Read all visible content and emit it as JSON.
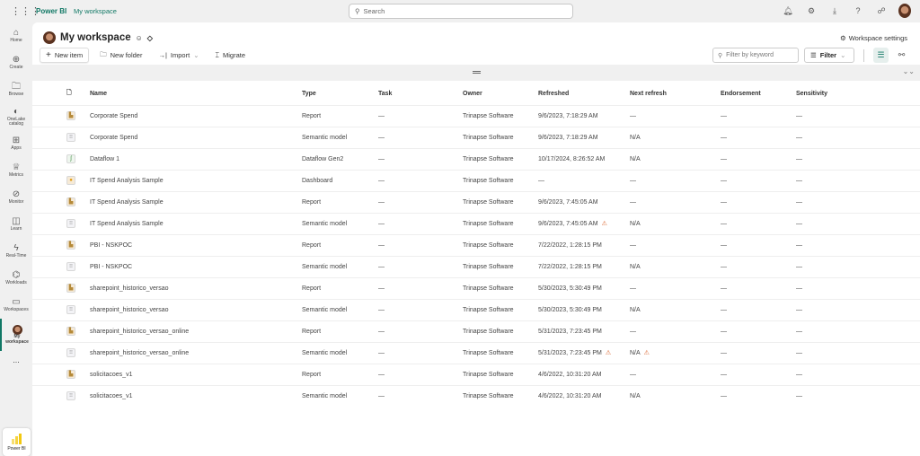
{
  "topbar": {
    "brand": "Power BI",
    "breadcrumb": "My workspace",
    "search_placeholder": "Search"
  },
  "sidebar": {
    "items": [
      {
        "label": "Home",
        "icon": "home-icon"
      },
      {
        "label": "Create",
        "icon": "plus-circle-icon"
      },
      {
        "label": "Browse",
        "icon": "folder-icon"
      },
      {
        "label": "OneLake catalog",
        "icon": "onelake-icon"
      },
      {
        "label": "Apps",
        "icon": "apps-icon"
      },
      {
        "label": "Metrics",
        "icon": "trophy-icon"
      },
      {
        "label": "Monitor",
        "icon": "monitor-icon"
      },
      {
        "label": "Learn",
        "icon": "book-icon"
      },
      {
        "label": "Real-Time",
        "icon": "lightning-icon"
      },
      {
        "label": "Workloads",
        "icon": "workloads-icon"
      },
      {
        "label": "Workspaces",
        "icon": "workspaces-icon"
      },
      {
        "label": "My workspace",
        "icon": "avatar"
      }
    ],
    "more": "...",
    "app_label": "Power BI"
  },
  "header": {
    "title": "My workspace",
    "settings": "Workspace settings",
    "new_item": "New item",
    "new_folder": "New folder",
    "import": "Import",
    "migrate": "Migrate",
    "filter_placeholder": "Filter by keyword",
    "filter": "Filter"
  },
  "table": {
    "columns": [
      "Name",
      "Type",
      "Task",
      "Owner",
      "Refreshed",
      "Next refresh",
      "Endorsement",
      "Sensitivity"
    ],
    "rows": [
      {
        "icon": "report",
        "name": "Corporate Spend",
        "type": "Report",
        "task": "—",
        "owner": "Trinapse Software",
        "refreshed": "9/6/2023, 7:18:29 AM",
        "refreshed_warn": false,
        "next": "—",
        "next_warn": false,
        "endorsement": "—",
        "sensitivity": "—"
      },
      {
        "icon": "model",
        "name": "Corporate Spend",
        "type": "Semantic model",
        "task": "—",
        "owner": "Trinapse Software",
        "refreshed": "9/6/2023, 7:18:29 AM",
        "refreshed_warn": false,
        "next": "N/A",
        "next_warn": false,
        "endorsement": "—",
        "sensitivity": "—"
      },
      {
        "icon": "dataflow",
        "name": "Dataflow 1",
        "type": "Dataflow Gen2",
        "task": "—",
        "owner": "Trinapse Software",
        "refreshed": "10/17/2024, 8:26:52 AM",
        "refreshed_warn": false,
        "next": "N/A",
        "next_warn": false,
        "endorsement": "—",
        "sensitivity": "—"
      },
      {
        "icon": "dashboard",
        "name": "IT Spend Analysis Sample",
        "type": "Dashboard",
        "task": "—",
        "owner": "Trinapse Software",
        "refreshed": "—",
        "refreshed_warn": false,
        "next": "—",
        "next_warn": false,
        "endorsement": "—",
        "sensitivity": "—"
      },
      {
        "icon": "report",
        "name": "IT Spend Analysis Sample",
        "type": "Report",
        "task": "—",
        "owner": "Trinapse Software",
        "refreshed": "9/6/2023, 7:45:05 AM",
        "refreshed_warn": false,
        "next": "—",
        "next_warn": false,
        "endorsement": "—",
        "sensitivity": "—"
      },
      {
        "icon": "model",
        "name": "IT Spend Analysis Sample",
        "type": "Semantic model",
        "task": "—",
        "owner": "Trinapse Software",
        "refreshed": "9/6/2023, 7:45:05 AM",
        "refreshed_warn": true,
        "next": "N/A",
        "next_warn": false,
        "endorsement": "—",
        "sensitivity": "—"
      },
      {
        "icon": "report",
        "name": "PBI - NSKPOC",
        "type": "Report",
        "task": "—",
        "owner": "Trinapse Software",
        "refreshed": "7/22/2022, 1:28:15 PM",
        "refreshed_warn": false,
        "next": "—",
        "next_warn": false,
        "endorsement": "—",
        "sensitivity": "—"
      },
      {
        "icon": "model",
        "name": "PBI - NSKPOC",
        "type": "Semantic model",
        "task": "—",
        "owner": "Trinapse Software",
        "refreshed": "7/22/2022, 1:28:15 PM",
        "refreshed_warn": false,
        "next": "N/A",
        "next_warn": false,
        "endorsement": "—",
        "sensitivity": "—"
      },
      {
        "icon": "report",
        "name": "sharepoint_historico_versao",
        "type": "Report",
        "task": "—",
        "owner": "Trinapse Software",
        "refreshed": "5/30/2023, 5:30:49 PM",
        "refreshed_warn": false,
        "next": "—",
        "next_warn": false,
        "endorsement": "—",
        "sensitivity": "—"
      },
      {
        "icon": "model",
        "name": "sharepoint_historico_versao",
        "type": "Semantic model",
        "task": "—",
        "owner": "Trinapse Software",
        "refreshed": "5/30/2023, 5:30:49 PM",
        "refreshed_warn": false,
        "next": "N/A",
        "next_warn": false,
        "endorsement": "—",
        "sensitivity": "—"
      },
      {
        "icon": "report",
        "name": "sharepoint_historico_versao_online",
        "type": "Report",
        "task": "—",
        "owner": "Trinapse Software",
        "refreshed": "5/31/2023, 7:23:45 PM",
        "refreshed_warn": false,
        "next": "—",
        "next_warn": false,
        "endorsement": "—",
        "sensitivity": "—"
      },
      {
        "icon": "model",
        "name": "sharepoint_historico_versao_online",
        "type": "Semantic model",
        "task": "—",
        "owner": "Trinapse Software",
        "refreshed": "5/31/2023, 7:23:45 PM",
        "refreshed_warn": true,
        "next": "N/A",
        "next_warn": true,
        "endorsement": "—",
        "sensitivity": "—"
      },
      {
        "icon": "report",
        "name": "solicitacoes_v1",
        "type": "Report",
        "task": "—",
        "owner": "Trinapse Software",
        "refreshed": "4/6/2022, 10:31:20 AM",
        "refreshed_warn": false,
        "next": "—",
        "next_warn": false,
        "endorsement": "—",
        "sensitivity": "—"
      },
      {
        "icon": "model",
        "name": "solicitacoes_v1",
        "type": "Semantic model",
        "task": "—",
        "owner": "Trinapse Software",
        "refreshed": "4/6/2022, 10:31:20 AM",
        "refreshed_warn": false,
        "next": "N/A",
        "next_warn": false,
        "endorsement": "—",
        "sensitivity": "—"
      }
    ]
  }
}
